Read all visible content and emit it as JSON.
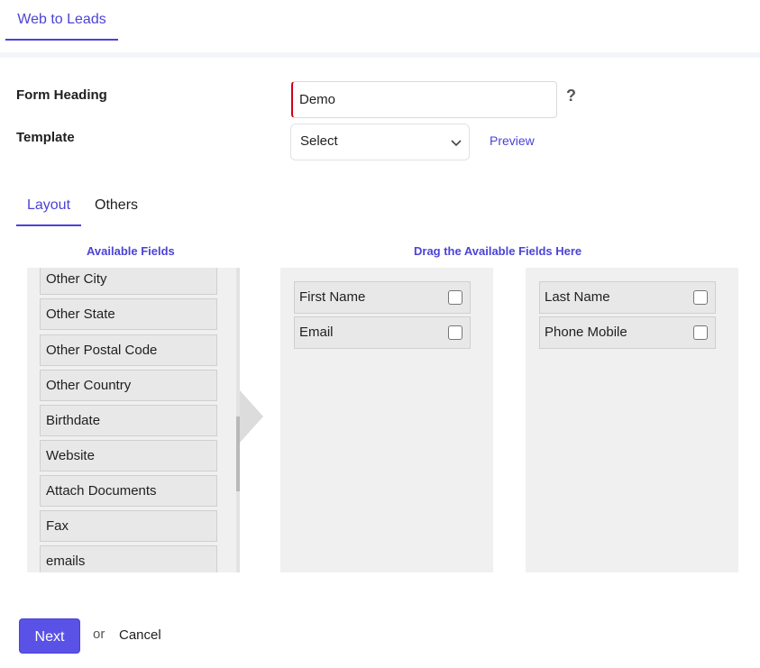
{
  "header": {
    "tab_label": "Web to Leads"
  },
  "form": {
    "heading_label": "Form Heading",
    "heading_value": "Demo",
    "help_symbol": "?",
    "template_label": "Template",
    "template_selected": "Select",
    "preview_label": "Preview"
  },
  "tabs": [
    {
      "label": "Layout",
      "active": true
    },
    {
      "label": "Others",
      "active": false
    }
  ],
  "available": {
    "title": "Available Fields",
    "items": [
      "Other City",
      "Other State",
      "Other Postal Code",
      "Other Country",
      "Birthdate",
      "Website",
      "Attach Documents",
      "Fax",
      "emails"
    ]
  },
  "drop": {
    "title": "Drag the Available Fields Here",
    "left_column": [
      "First Name",
      "Email"
    ],
    "right_column": [
      "Last Name",
      "Phone Mobile"
    ]
  },
  "actions": {
    "next_label": "Next",
    "or_label": "or",
    "cancel_label": "Cancel"
  },
  "colors": {
    "accent": "#4b43d6",
    "required": "#d0021b",
    "button": "#5a52e6"
  },
  "icons": {
    "help": "question-mark-icon",
    "dropdown": "chevron-down-icon"
  }
}
